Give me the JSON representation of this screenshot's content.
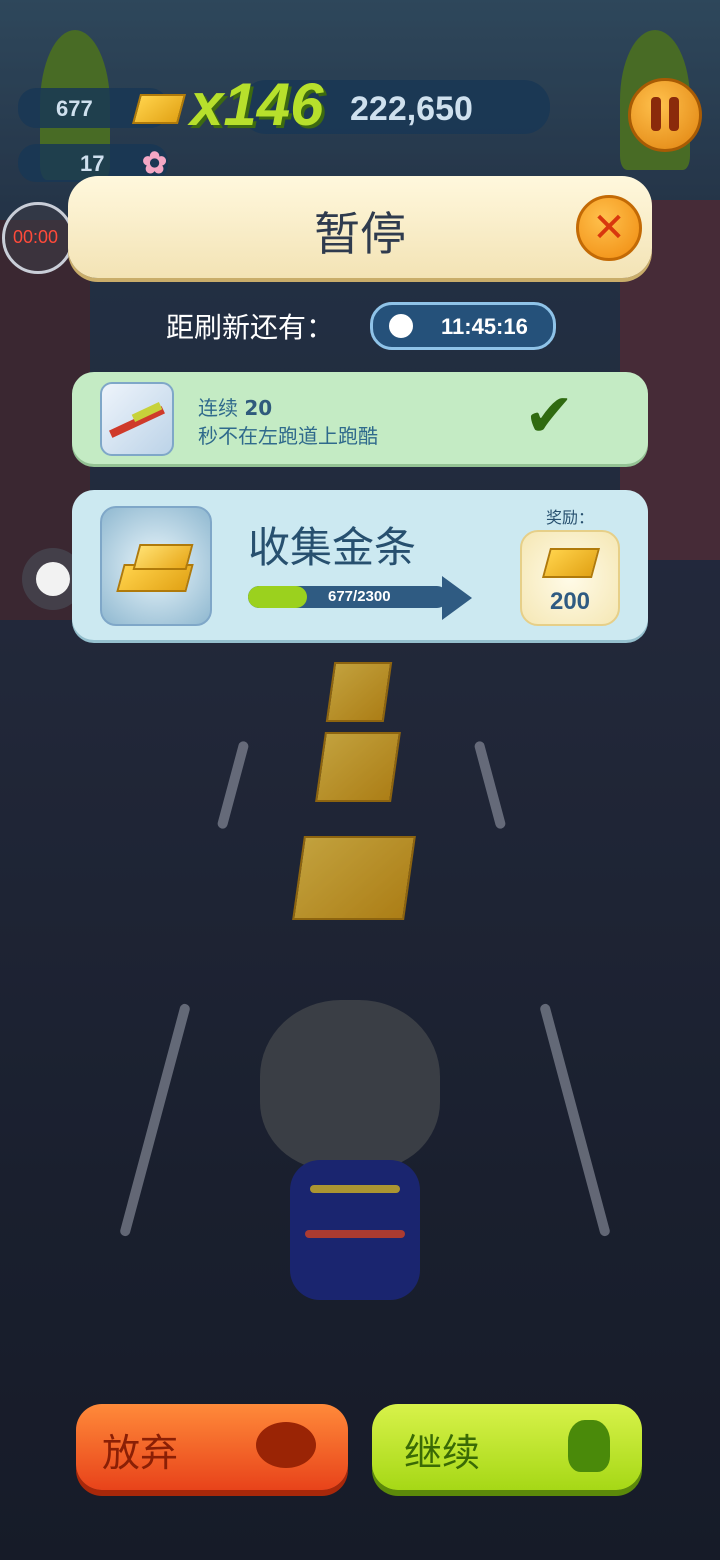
{
  "hud": {
    "gold_count": "677",
    "flower_count": "17",
    "multiplier": "x146",
    "score": "222,650",
    "record_time": "00:00"
  },
  "pause_panel": {
    "title": "暂停",
    "refresh_label": "距刷新还有：",
    "refresh_time": "11:45:16"
  },
  "mission_completed": {
    "line1_prefix": "连续 ",
    "line1_value": "20",
    "line2": "秒不在左跑道上跑酷",
    "status": "completed"
  },
  "mission_active": {
    "title": "收集金条",
    "progress_text": "677/2300",
    "progress_fraction": 0.294,
    "reward_label": "奖励：",
    "reward_value": "200"
  },
  "buttons": {
    "quit_label": "放弃",
    "continue_label": "继续"
  },
  "colors": {
    "quit_button": "#f05a1f",
    "continue_button": "#b3e31c",
    "progress_fill": "#9bd11e"
  }
}
